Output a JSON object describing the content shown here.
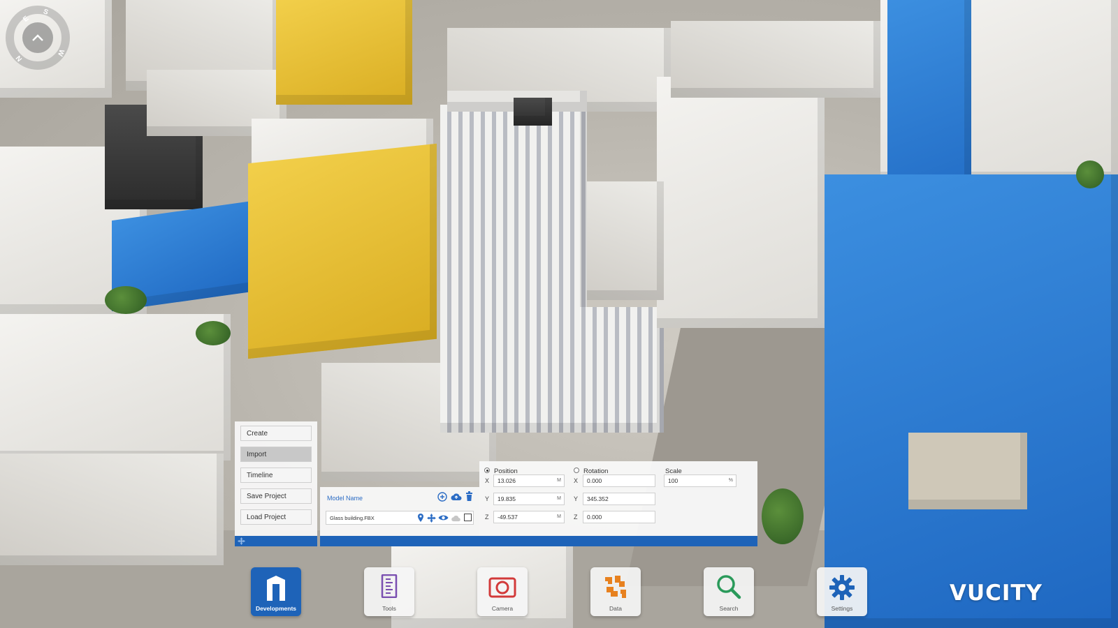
{
  "compass": {
    "n": "N",
    "s": "S",
    "e": "E",
    "w": "W"
  },
  "menu": {
    "items": [
      {
        "label": "Create"
      },
      {
        "label": "Import"
      },
      {
        "label": "Timeline"
      },
      {
        "label": "Save Project"
      },
      {
        "label": "Load Project"
      }
    ],
    "active": "Import"
  },
  "model": {
    "header": "Model Name",
    "file_name": "Glass building.FBX"
  },
  "transform": {
    "position_label": "Position",
    "rotation_label": "Rotation",
    "scale_label": "Scale",
    "position": {
      "x": "13.026",
      "y": "19.835",
      "z": "-49.537",
      "unit": "M"
    },
    "rotation": {
      "x": "0.000",
      "y": "345.352",
      "z": "0.000"
    },
    "scale": {
      "value": "100",
      "unit": "%"
    },
    "axes": {
      "x": "X",
      "y": "Y",
      "z": "Z"
    }
  },
  "dock": [
    {
      "label": "Developments"
    },
    {
      "label": "Tools"
    },
    {
      "label": "Camera"
    },
    {
      "label": "Data"
    },
    {
      "label": "Search"
    },
    {
      "label": "Settings"
    }
  ],
  "logo": "VUCITY",
  "colors": {
    "accent": "#1e63b8",
    "yellow_building": "#e9be34",
    "blue_building": "#2a7ad6"
  }
}
